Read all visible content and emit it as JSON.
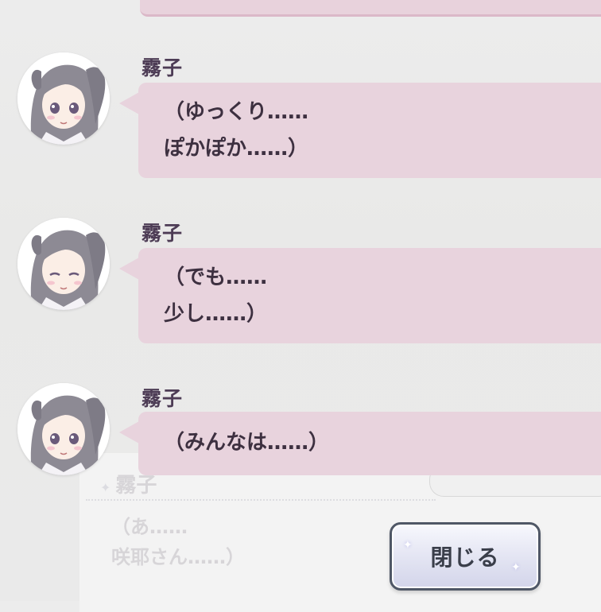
{
  "messages": [
    {
      "speaker": "霧子",
      "avatar": "kiriko-avatar",
      "text": "（ゆっくり……\nぽかぽか……）"
    },
    {
      "speaker": "霧子",
      "avatar": "kiriko-avatar",
      "text": "（でも……\n少し……）"
    },
    {
      "speaker": "霧子",
      "avatar": "kiriko-avatar",
      "text": "（みんなは……）"
    }
  ],
  "background_log": {
    "speaker": "霧子",
    "text": "（あ……\n咲耶さん……）"
  },
  "close_button": {
    "label": "閉じる"
  },
  "colors": {
    "bubble": "#e8d3dd",
    "name_text": "#4d3c55",
    "message_text": "#3d3040",
    "button_border": "#4f5766"
  }
}
